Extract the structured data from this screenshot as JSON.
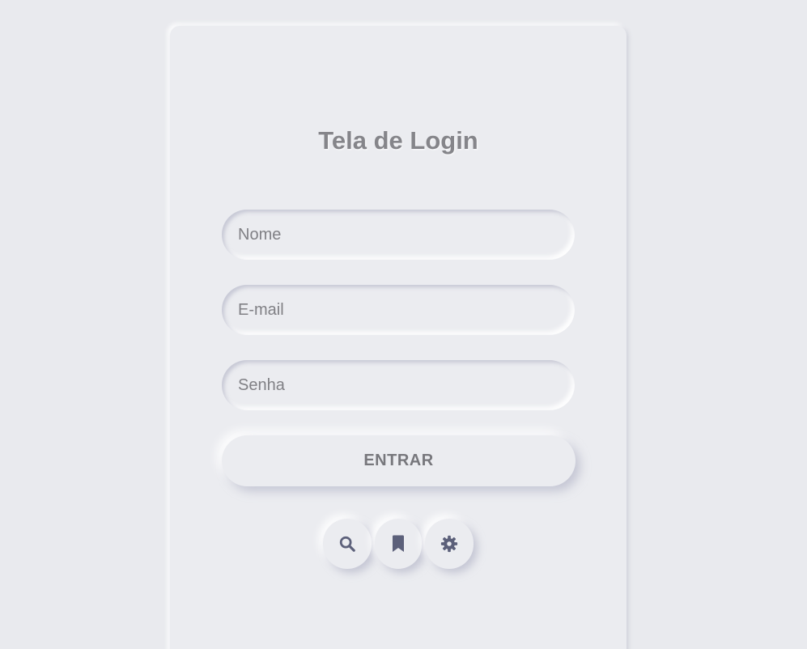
{
  "login": {
    "title": "Tela de Login",
    "fields": {
      "name": {
        "placeholder": "Nome",
        "value": ""
      },
      "email": {
        "placeholder": "E-mail",
        "value": ""
      },
      "password": {
        "placeholder": "Senha",
        "value": ""
      }
    },
    "submit_label": "ENTRAR"
  },
  "icon_buttons": [
    {
      "icon": "search-icon"
    },
    {
      "icon": "bookmark-icon"
    },
    {
      "icon": "gear-icon"
    }
  ],
  "colors": {
    "background": "#e9eaee",
    "card": "#ebecf0",
    "title_text": "#85858a",
    "icon": "#5c607a"
  }
}
